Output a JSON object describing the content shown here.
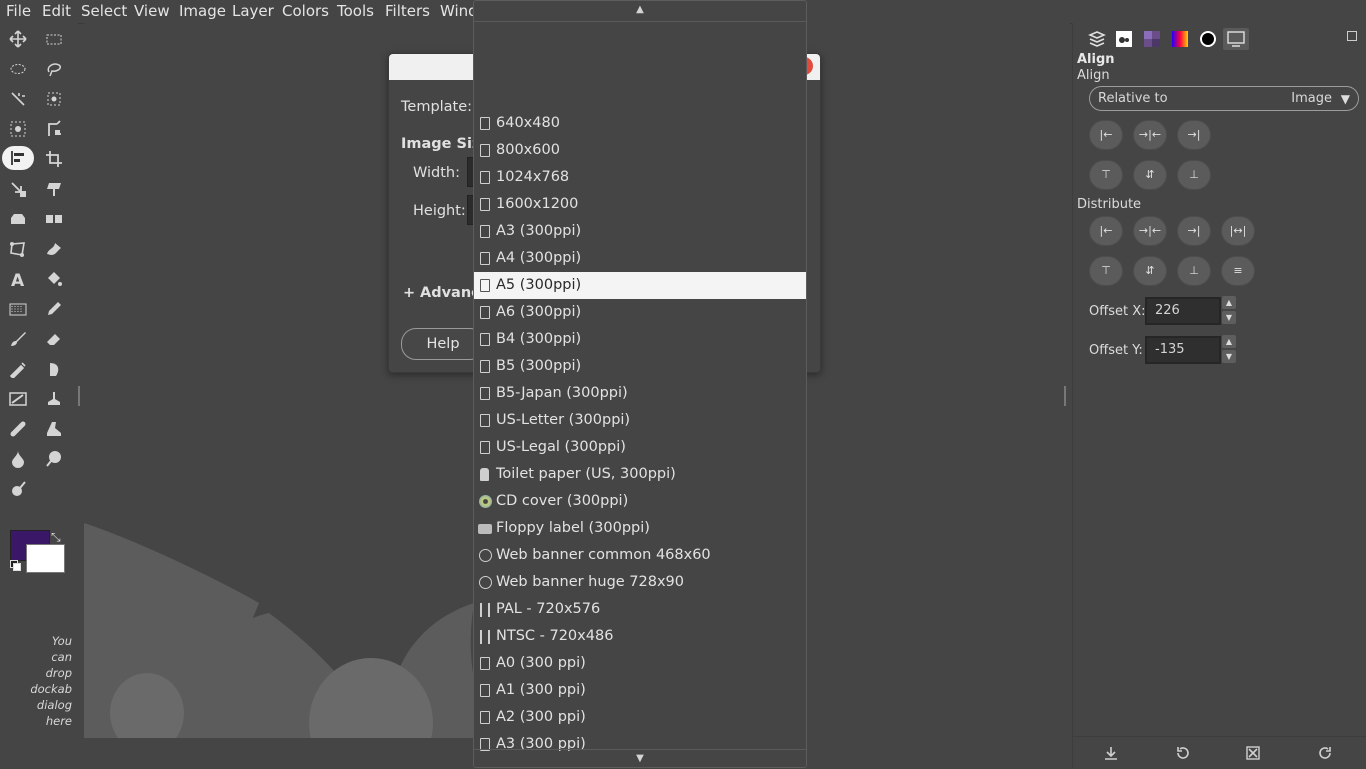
{
  "menubar": {
    "items": [
      "File",
      "Edit",
      "Select",
      "View",
      "Image",
      "Layer",
      "Colors",
      "Tools",
      "Filters",
      "Wind"
    ]
  },
  "toolbox": {
    "drop_hint": [
      "You",
      "can",
      "drop",
      "dockab",
      "dialog",
      "here"
    ],
    "fg_color": "#3b1767",
    "bg_color": "#ffffff"
  },
  "dialog": {
    "template_label": "Template:",
    "image_size_label": "Image Size",
    "width_label": "Width:",
    "height_label": "Height:",
    "advanced_label": "Advance",
    "advanced_icon": "+",
    "help_button": "Help"
  },
  "dropdown": {
    "selected_index": 6,
    "items": [
      {
        "label": "640x480",
        "icon": "document-icon"
      },
      {
        "label": "800x600",
        "icon": "document-icon"
      },
      {
        "label": "1024x768",
        "icon": "document-icon"
      },
      {
        "label": "1600x1200",
        "icon": "document-icon"
      },
      {
        "label": "A3 (300ppi)",
        "icon": "document-icon"
      },
      {
        "label": "A4 (300ppi)",
        "icon": "document-icon"
      },
      {
        "label": "A5 (300ppi)",
        "icon": "document-icon"
      },
      {
        "label": "A6 (300ppi)",
        "icon": "document-icon"
      },
      {
        "label": "B4 (300ppi)",
        "icon": "document-icon"
      },
      {
        "label": "B5 (300ppi)",
        "icon": "document-icon"
      },
      {
        "label": "B5-Japan (300ppi)",
        "icon": "document-icon"
      },
      {
        "label": "US-Letter (300ppi)",
        "icon": "document-icon"
      },
      {
        "label": "US-Legal (300ppi)",
        "icon": "document-icon"
      },
      {
        "label": "Toilet paper (US, 300ppi)",
        "icon": "toilet-paper-icon"
      },
      {
        "label": "CD cover (300ppi)",
        "icon": "cd-icon"
      },
      {
        "label": "Floppy label (300ppi)",
        "icon": "wilber-icon"
      },
      {
        "label": "Web banner common 468x60",
        "icon": "web-icon"
      },
      {
        "label": "Web banner huge 728x90",
        "icon": "web-icon"
      },
      {
        "label": "PAL - 720x576",
        "icon": "film-icon"
      },
      {
        "label": "NTSC - 720x486",
        "icon": "film-icon"
      },
      {
        "label": "A0 (300 ppi)",
        "icon": "document-icon"
      },
      {
        "label": "A1 (300 ppi)",
        "icon": "document-icon"
      },
      {
        "label": "A2 (300 ppi)",
        "icon": "document-icon"
      },
      {
        "label": "A3 (300 ppi)",
        "icon": "document-icon"
      }
    ]
  },
  "dock": {
    "title": "Align",
    "subtitle": "Align",
    "relative_to_label": "Relative to",
    "relative_to_value": "Image",
    "distribute_label": "Distribute",
    "offset_x_label": "Offset X:",
    "offset_x_value": "226",
    "offset_y_label": "Offset Y:",
    "offset_y_value": "-135"
  }
}
